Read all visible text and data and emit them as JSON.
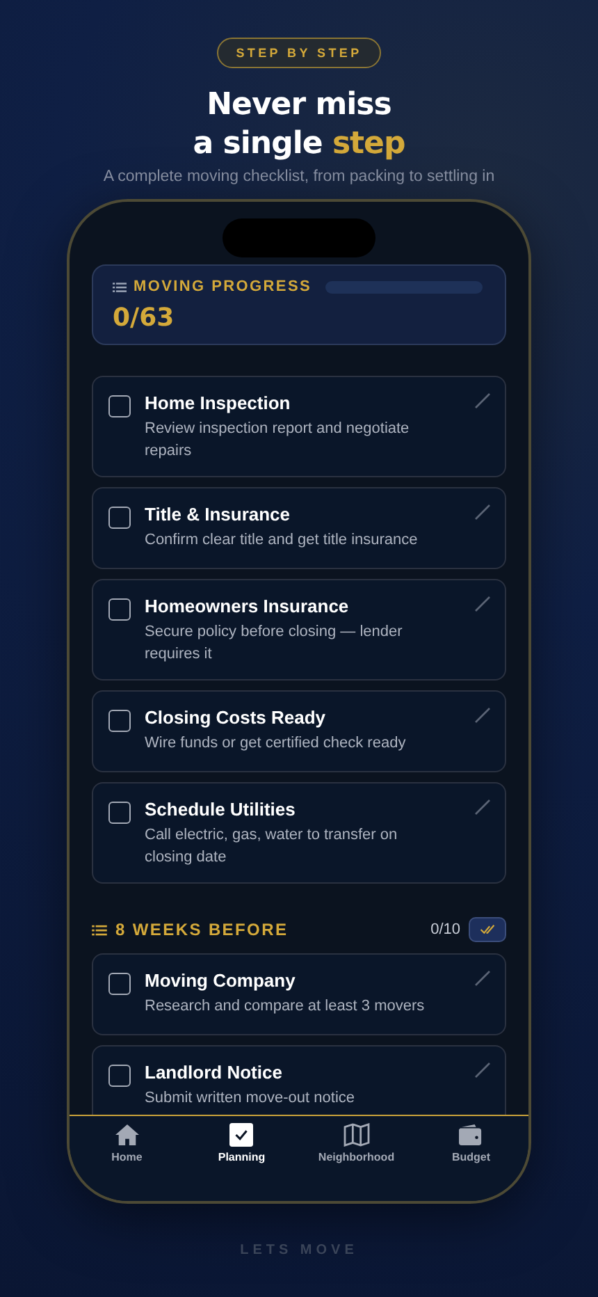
{
  "badge": "STEP BY STEP",
  "headline": {
    "line1": "Never miss",
    "line2": "a single",
    "accent": "step"
  },
  "subtitle": "A complete moving checklist, from packing to settling in",
  "progress": {
    "label": "MOVING PROGRESS",
    "count": "0/63",
    "level": 0
  },
  "tasks": [
    {
      "title": "Home Inspection",
      "desc": "Review inspection report and negotiate repairs",
      "checked": false
    },
    {
      "title": "Title & Insurance",
      "desc": "Confirm clear title and get title insurance",
      "checked": false
    },
    {
      "title": "Homeowners Insurance",
      "desc": "Secure policy before closing — lender requires it",
      "checked": false
    },
    {
      "title": "Closing Costs Ready",
      "desc": "Wire funds or get certified check ready",
      "checked": false
    },
    {
      "title": "Schedule Utilities",
      "desc": "Call electric, gas, water to transfer on closing date",
      "checked": false
    }
  ],
  "section": {
    "title": "8 WEEKS BEFORE",
    "count": "0/10",
    "tasks": [
      {
        "title": "Moving Company",
        "desc": "Research and compare at least 3 movers",
        "checked": false
      },
      {
        "title": "Landlord Notice",
        "desc": "Submit written move-out notice",
        "checked": false
      }
    ]
  },
  "nav": [
    {
      "label": "Home",
      "kind": "home",
      "selected": false
    },
    {
      "label": "Planning",
      "kind": "check",
      "selected": true
    },
    {
      "label": "Neighborhood",
      "kind": "map",
      "selected": false
    },
    {
      "label": "Budget",
      "kind": "wallet",
      "selected": false
    }
  ],
  "footer": "LETS MOVE"
}
